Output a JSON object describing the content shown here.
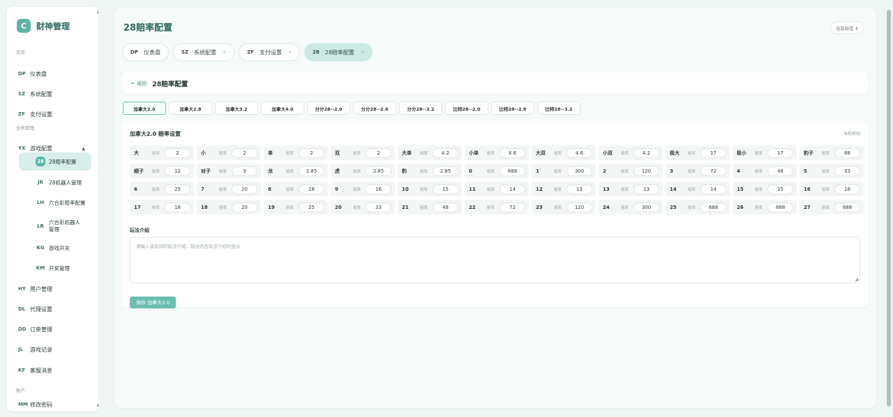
{
  "app": {
    "logo_letter": "C",
    "title": "财神管理"
  },
  "sidebar": {
    "sections": [
      "总览",
      "业务管理",
      "账户"
    ],
    "items": [
      {
        "abbr": "DP",
        "label": "仪表盘"
      },
      {
        "abbr": "SZ",
        "label": "系统配置"
      },
      {
        "abbr": "ZF",
        "label": "支付设置"
      },
      {
        "abbr": "YX",
        "label": "游戏配置",
        "caret": "▲"
      },
      {
        "abbr": "HY",
        "label": "用户管理"
      },
      {
        "abbr": "DL",
        "label": "代理设置"
      },
      {
        "abbr": "DD",
        "label": "订单管理"
      },
      {
        "abbr": "JL",
        "label": "游戏记录"
      },
      {
        "abbr": "KF",
        "label": "客服消息"
      },
      {
        "abbr": "MM",
        "label": "修改密码"
      }
    ],
    "subitems": [
      {
        "abbr": "28",
        "label": "28赔率配置"
      },
      {
        "abbr": "JR",
        "label": "28机器人管理"
      },
      {
        "abbr": "LH",
        "label": "六合彩赔率配置"
      },
      {
        "abbr": "LR",
        "label": "六合彩机器人管理"
      },
      {
        "abbr": "KG",
        "label": "游戏开关"
      },
      {
        "abbr": "KM",
        "label": "开奖管理"
      }
    ]
  },
  "header": {
    "title": "28赔率配置",
    "tag_count": "当前标签 4"
  },
  "tabs": [
    {
      "abbr": "DP",
      "label": "仪表盘"
    },
    {
      "abbr": "SZ",
      "label": "系统配置",
      "close": "×"
    },
    {
      "abbr": "ZF",
      "label": "支付设置",
      "close": "×"
    },
    {
      "abbr": "28",
      "label": "28赔率配置",
      "close": "×"
    }
  ],
  "back": {
    "link": "← 返回",
    "title": "28赔率配置"
  },
  "variants": [
    "加拿大2.0",
    "加拿大2.8",
    "加拿大3.2",
    "加拿大4.0",
    "分分28--2.0",
    "分分28--2.8",
    "分分28--3.2",
    "比特28--2.0",
    "比特28--2.8",
    "比特28--3.2"
  ],
  "settings": {
    "title": "加拿大2.0 赔率设置",
    "right_label": "当前房间",
    "odds_placeholder": "赔率",
    "odds": [
      {
        "name": "大",
        "value": "2"
      },
      {
        "name": "小",
        "value": "2"
      },
      {
        "name": "单",
        "value": "2"
      },
      {
        "name": "双",
        "value": "2"
      },
      {
        "name": "大单",
        "value": "4.2"
      },
      {
        "name": "小单",
        "value": "4.6"
      },
      {
        "name": "大双",
        "value": "4.6"
      },
      {
        "name": "小双",
        "value": "4.2"
      },
      {
        "name": "极大",
        "value": "17"
      },
      {
        "name": "极小",
        "value": "17"
      },
      {
        "name": "豹子",
        "value": "88"
      },
      {
        "name": "顺子",
        "value": "12"
      },
      {
        "name": "对子",
        "value": "3"
      },
      {
        "name": "龙",
        "value": "2.85"
      },
      {
        "name": "虎",
        "value": "2.85"
      },
      {
        "name": "豹",
        "value": "2.85"
      },
      {
        "name": "0",
        "value": "688"
      },
      {
        "name": "1",
        "value": "300"
      },
      {
        "name": "2",
        "value": "120"
      },
      {
        "name": "3",
        "value": "72"
      },
      {
        "name": "4",
        "value": "48"
      },
      {
        "name": "5",
        "value": "33"
      },
      {
        "name": "6",
        "value": "25"
      },
      {
        "name": "7",
        "value": "20"
      },
      {
        "name": "8",
        "value": "18"
      },
      {
        "name": "9",
        "value": "16"
      },
      {
        "name": "10",
        "value": "15"
      },
      {
        "name": "11",
        "value": "14"
      },
      {
        "name": "12",
        "value": "13"
      },
      {
        "name": "13",
        "value": "13"
      },
      {
        "name": "14",
        "value": "14"
      },
      {
        "name": "15",
        "value": "15"
      },
      {
        "name": "16",
        "value": "16"
      },
      {
        "name": "17",
        "value": "18"
      },
      {
        "name": "18",
        "value": "20"
      },
      {
        "name": "19",
        "value": "25"
      },
      {
        "name": "20",
        "value": "33"
      },
      {
        "name": "21",
        "value": "48"
      },
      {
        "name": "22",
        "value": "72"
      },
      {
        "name": "23",
        "value": "120"
      },
      {
        "name": "24",
        "value": "300"
      },
      {
        "name": "25",
        "value": "688"
      },
      {
        "name": "26",
        "value": "888"
      },
      {
        "name": "27",
        "value": "888"
      }
    ],
    "intro_label": "玩法介绍",
    "intro_placeholder": "请输入该房间的玩法介绍，前台点击玩法介绍时显示",
    "save_label": "保存 加拿大2.0"
  }
}
